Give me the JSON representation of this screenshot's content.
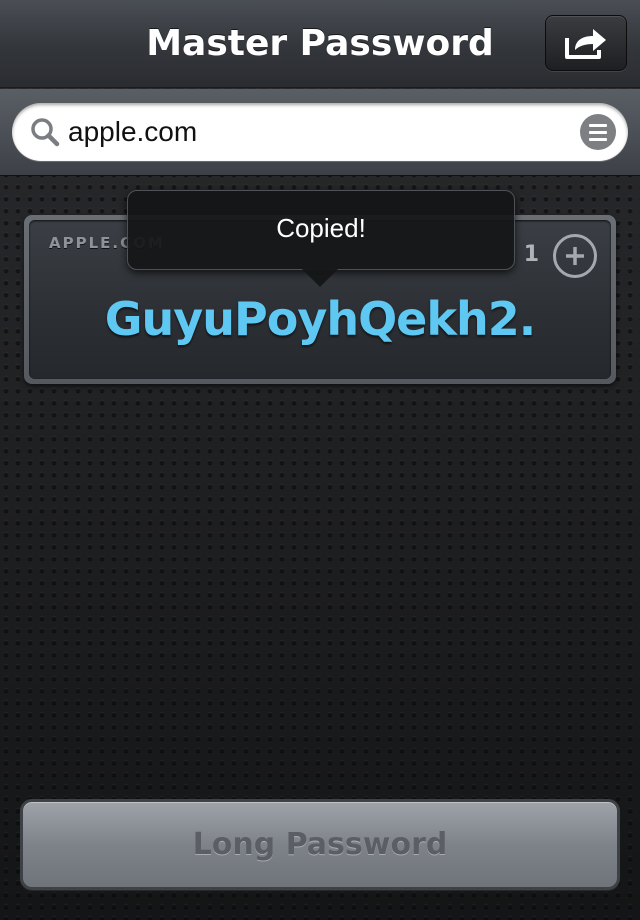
{
  "navbar": {
    "title": "Master Password",
    "share_icon": "share-icon"
  },
  "search": {
    "value": "apple.com",
    "search_icon": "search-icon",
    "menu_icon": "menu-icon"
  },
  "site": {
    "name": "APPLE.COM",
    "counter": "1",
    "password": "GuyuPoyhQekh2."
  },
  "tooltip": {
    "text": "Copied!"
  },
  "footer": {
    "button_label": "Long Password"
  },
  "colors": {
    "password_text": "#5ec8f3",
    "navbar": "#33363b",
    "background": "#1a1b1d"
  }
}
